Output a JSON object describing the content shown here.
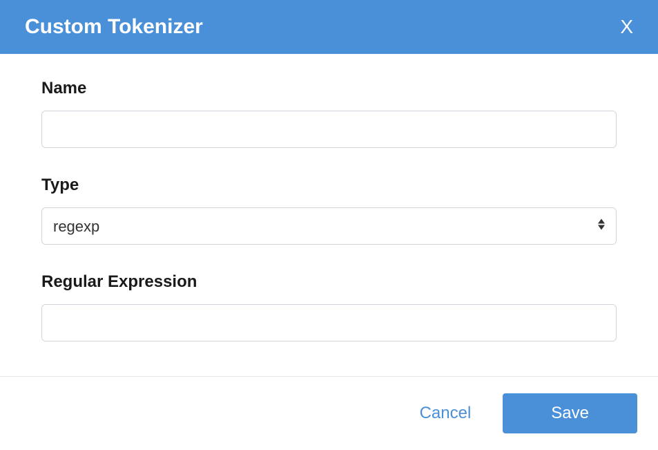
{
  "header": {
    "title": "Custom Tokenizer",
    "close_label": "X"
  },
  "form": {
    "name": {
      "label": "Name",
      "value": ""
    },
    "type": {
      "label": "Type",
      "selected": "regexp"
    },
    "regex": {
      "label": "Regular Expression",
      "value": ""
    }
  },
  "footer": {
    "cancel_label": "Cancel",
    "save_label": "Save"
  }
}
